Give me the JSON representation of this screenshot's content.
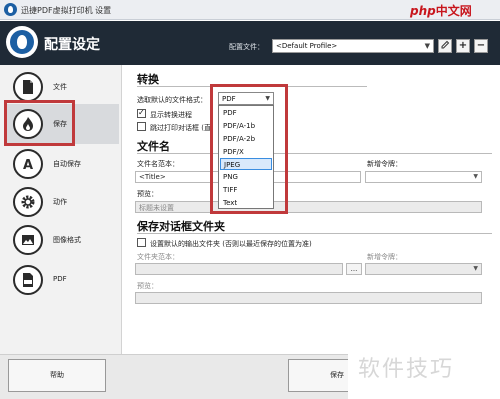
{
  "window": {
    "title": "迅捷PDF虚拟打印机 设置"
  },
  "watermark": {
    "part1": "php",
    "part2": "中文网"
  },
  "header": {
    "title": "配置设定",
    "profile_label": "配置文件：",
    "profile_value": "<Default Profile>"
  },
  "nav": {
    "items": [
      {
        "label": "文件",
        "icon": "document-icon"
      },
      {
        "label": "保存",
        "icon": "save-flame-icon"
      },
      {
        "label": "自动保存",
        "icon": "auto-save-icon"
      },
      {
        "label": "动作",
        "icon": "gear-icon"
      },
      {
        "label": "图像格式",
        "icon": "image-icon"
      },
      {
        "label": "PDF",
        "icon": "pdf-icon"
      }
    ],
    "active_index": 1
  },
  "convert": {
    "heading": "转换",
    "format_label": "选取默认的文件格式：",
    "format_value": "PDF",
    "show_progress_label": "显示转换进程",
    "show_progress_checked": true,
    "skip_print_label": "跳过打印对话框 (直",
    "skip_print_checked": false,
    "format_options": [
      "PDF",
      "PDF/A-1b",
      "PDF/A-2b",
      "PDF/X",
      "JPEG",
      "PNG",
      "TIFF",
      "Text"
    ],
    "highlighted_option": "JPEG"
  },
  "filename": {
    "heading": "文件名",
    "template_label": "文件名范本：",
    "template_value": "<Title>",
    "add_token_label": "新增令牌：",
    "preview_label": "预览：",
    "preview_value": "标题未设置"
  },
  "savedialog": {
    "heading": "保存对话框文件夹",
    "default_folder_label": "设置默认的输出文件夹 (否则以最近保存的位置为准)",
    "default_folder_checked": false,
    "folder_template_label": "文件夹范本：",
    "browse_label": "...",
    "add_token_label": "新增令牌：",
    "preview_label": "预览："
  },
  "bottom": {
    "help_label": "帮助",
    "save_label": "保存"
  },
  "corner_watermark": "软件技巧",
  "colors": {
    "header_bg": "#1f2a36",
    "highlight_red": "#c0393b",
    "selection_blue": "#3a8de0"
  }
}
